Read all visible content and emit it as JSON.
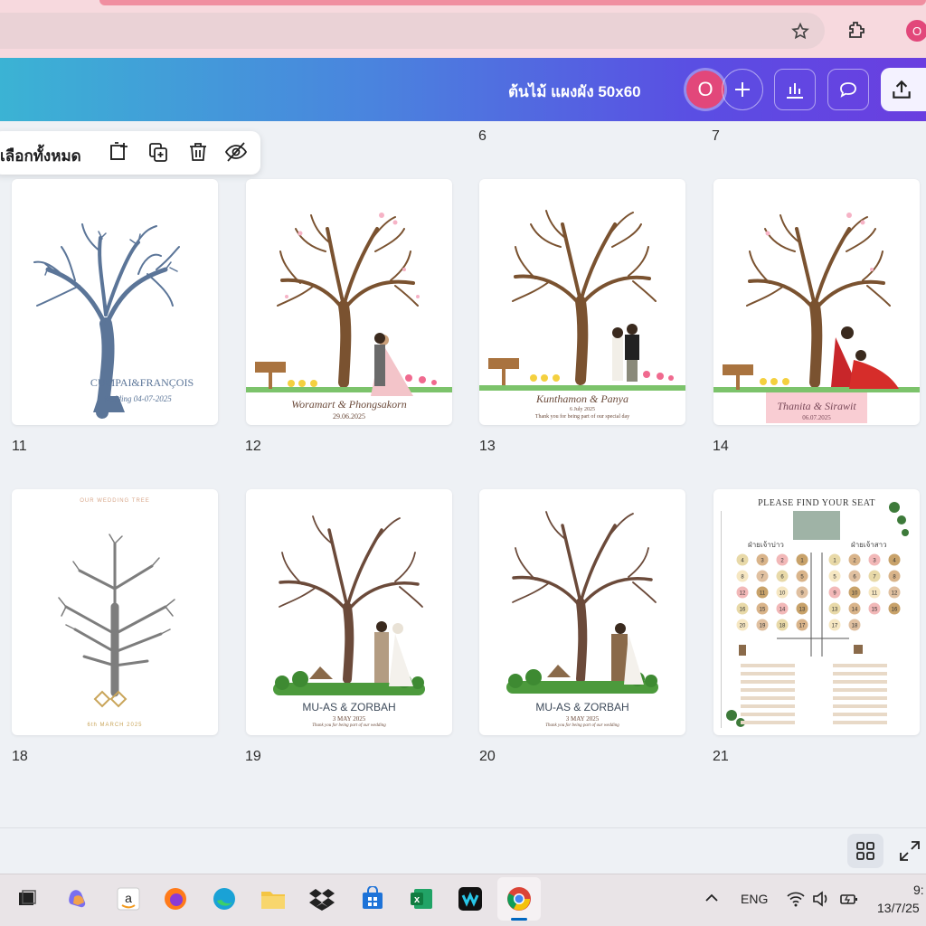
{
  "browser": {
    "profile_letter": "O",
    "icons": [
      "star-icon",
      "extensions-icon"
    ]
  },
  "header": {
    "title": "ต้นไม้ แผงผัง 50x60",
    "avatar_letter": "O",
    "buttons": [
      "add-collaborator",
      "insights",
      "comments",
      "share"
    ]
  },
  "selection_toolbar": {
    "select_all_label": "เลือกทั้งหมด",
    "icons": [
      "add-page-icon",
      "duplicate-page-icon",
      "delete-page-icon",
      "hide-page-icon"
    ]
  },
  "top_page_numbers": [
    "6",
    "7"
  ],
  "pages": [
    {
      "num": "11",
      "caption_1": "CUMPAI&FRANÇOIS",
      "caption_2": "Wedding 04-07-2025"
    },
    {
      "num": "12",
      "caption_1": "Woramart & Phongsakorn",
      "caption_2": "29.06.2025"
    },
    {
      "num": "13",
      "caption_1": "Kunthamon & Panya",
      "caption_2": "6 July 2025",
      "caption_3": "Thank you for being part of our special day"
    },
    {
      "num": "14",
      "caption_1": "Thanita & Sirawit",
      "caption_2": "06.07.2025"
    },
    {
      "num": "18",
      "caption_1": "OUR WEDDING TREE",
      "caption_2": "6th MARCH 2025"
    },
    {
      "num": "19",
      "caption_1": "MU-AS & ZORBAH",
      "caption_2": "3 MAY 2025",
      "caption_3": "Thank you for being part of our wedding"
    },
    {
      "num": "20",
      "caption_1": "MU-AS & ZORBAH",
      "caption_2": "3 MAY 2025",
      "caption_3": "Thank you for being part of our wedding"
    },
    {
      "num": "21",
      "caption_1": "PLEASE FIND YOUR SEAT",
      "caption_2": "ฝ่ายเจ้าบ่าว",
      "caption_3": "ฝ่ายเจ้าสาว"
    }
  ],
  "seat_numbers_left": [
    "4",
    "3",
    "2",
    "1",
    "8",
    "7",
    "6",
    "5",
    "12",
    "11",
    "10",
    "9",
    "16",
    "15",
    "14",
    "13",
    "20",
    "19",
    "18",
    "17"
  ],
  "seat_numbers_right": [
    "1",
    "2",
    "3",
    "4",
    "5",
    "6",
    "7",
    "8",
    "9",
    "10",
    "11",
    "12",
    "13",
    "14",
    "15",
    "16",
    "17",
    "18"
  ],
  "taskbar": {
    "apps": [
      "task-view",
      "copilot",
      "amazon",
      "firefox",
      "edge",
      "file-explorer",
      "dropbox",
      "store",
      "excel",
      "webex",
      "chrome"
    ],
    "lang": "ENG",
    "time": "9:",
    "date": "13/7/25"
  },
  "colors": {
    "header_start": "#3bb3d4",
    "header_end": "#6a3ee0",
    "avatar": "#e2477a",
    "tree_brown": "#7a5230",
    "tree_blue": "#5b7598",
    "tree_grey": "#7d7d7d"
  }
}
